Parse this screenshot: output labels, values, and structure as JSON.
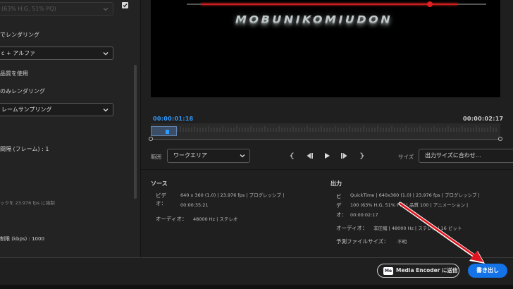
{
  "left_panel": {
    "top_dropdown_value": "(63% H.G, 51% PQ)",
    "render_label": "でレンダリング",
    "alpha_dropdown_value": "c + アルファ",
    "quality_label": "品質を使用",
    "only_render_label": "のみレンダリング",
    "frame_sampling_value": "レームサンプリング",
    "keyframe_label": "間隔 (フレーム) : 1",
    "fps_note": "ックを 23.976 fps に強制",
    "bitrate_label": "制限 (kbps) : 1000"
  },
  "preview": {
    "caption": "MOBUNIKOMIUDON"
  },
  "timeline": {
    "current_time": "00:00:01:18",
    "end_time": "00:00:02:17"
  },
  "controls": {
    "range_label": "範囲",
    "range_value": "ワークエリア",
    "size_label": "サイズ",
    "size_value": "出力サイズに合わせ…"
  },
  "source": {
    "title": "ソース",
    "video_key": "ビデオ：",
    "video_line1": "640 x 360 (1.0) | 23.976 fps | プログレッシブ |",
    "video_line2": "00:00:35:21",
    "audio_key": "オーディオ：",
    "audio_value": "48000 Hz | ステレオ"
  },
  "output": {
    "title": "出力",
    "video_key": "ビデオ：",
    "video_line1": "QuickTime | 640x360 (1.0) | 23.976 fps | プログレッシブ |",
    "video_line2": "100 (63% H.G, 51% PQ) | 品質 100 | アニメーション |",
    "video_line3": "00:00:02:17",
    "audio_key": "オーディオ：",
    "audio_value": "非圧縮 | 48000 Hz | ステレオ | 16 ビット",
    "filesize_key": "予測ファイルサイズ：",
    "filesize_value": "不明"
  },
  "footer": {
    "me_icon_text": "Me",
    "media_encoder_label": "Media Encoder に送信",
    "export_label": "書き出し"
  },
  "colors": {
    "accent": "#1473e6",
    "timecode_blue": "#2f9bff",
    "annotation_red": "#e0141e"
  }
}
